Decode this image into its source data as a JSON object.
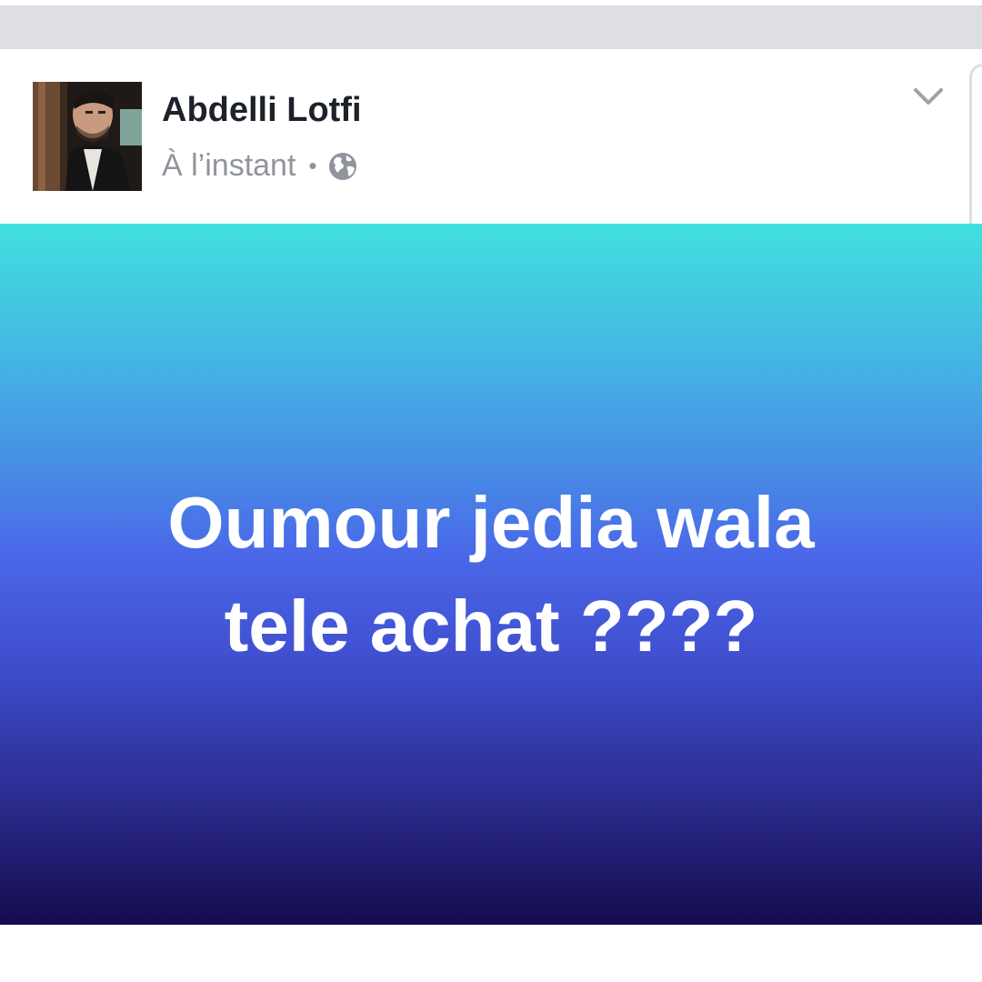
{
  "post": {
    "author": "Abdelli Lotfi",
    "timestamp": "À l’instant",
    "separator": "•",
    "privacy_icon": "globe-icon",
    "menu_icon": "chevron-down-icon",
    "text": "Oumour jedia wala tele achat ????",
    "background_gradient": [
      "#41e0de",
      "#4a68e8",
      "#160b4e"
    ],
    "text_color": "#ffffff"
  },
  "colors": {
    "top_strip": "#dddfe2",
    "name": "#1d2129",
    "meta": "#90949c"
  }
}
